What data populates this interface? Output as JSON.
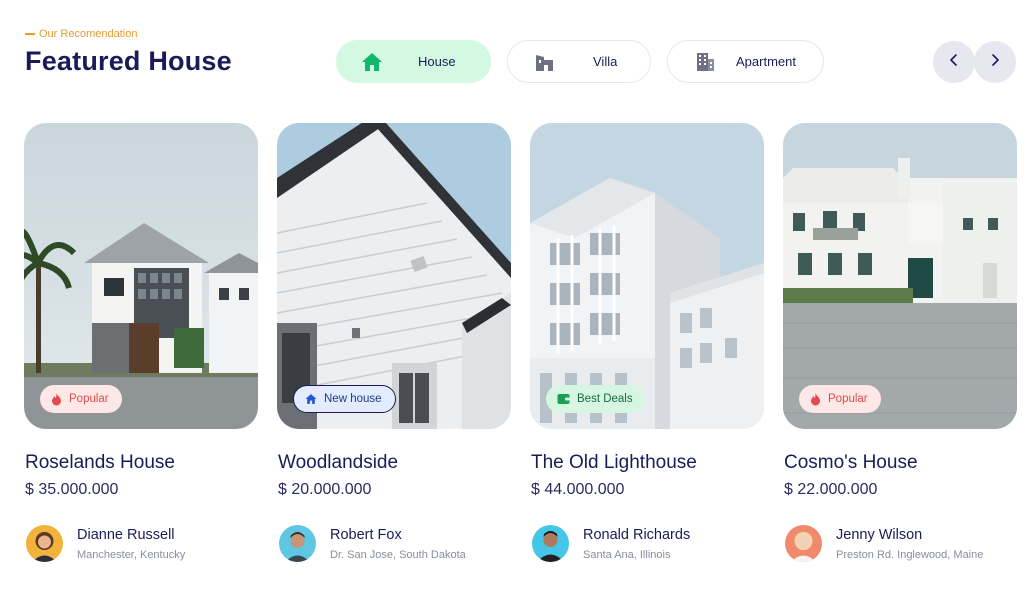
{
  "header": {
    "eyebrow": "Our Recomendation",
    "title": "Featured House"
  },
  "tabs": [
    {
      "label": "House",
      "icon": "home-icon",
      "active": true
    },
    {
      "label": "Villa",
      "icon": "villa-icon",
      "active": false
    },
    {
      "label": "Apartment",
      "icon": "apartment-icon",
      "active": false
    }
  ],
  "navigation": {
    "prev_icon": "chevron-left-icon",
    "next_icon": "chevron-right-icon"
  },
  "cards": [
    {
      "name": "Roselands House",
      "price": "$ 35.000.000",
      "badge": "Popular",
      "badge_icon": "fire-icon",
      "agent": {
        "name": "Dianne Russell",
        "location": "Manchester, Kentucky"
      }
    },
    {
      "name": "Woodlandside",
      "price": "$ 20.000.000",
      "badge": "New house",
      "badge_icon": "home-icon",
      "agent": {
        "name": "Robert Fox",
        "location": "Dr. San Jose, South Dakota"
      }
    },
    {
      "name": "The Old Lighthouse",
      "price": "$ 44.000.000",
      "badge": "Best Deals",
      "badge_icon": "wallet-icon",
      "agent": {
        "name": "Ronald Richards",
        "location": "Santa Ana, Illinois"
      }
    },
    {
      "name": "Cosmo's House",
      "price": "$ 22.000.000",
      "badge": "Popular",
      "badge_icon": "fire-icon",
      "agent": {
        "name": "Jenny Wilson",
        "location": "Preston Rd. Inglewood, Maine"
      }
    }
  ],
  "colors": {
    "accent": "#e69b2e",
    "title": "#1b1c57",
    "active_tab": "#d4f9e3",
    "house_icon": "#10b86a"
  }
}
